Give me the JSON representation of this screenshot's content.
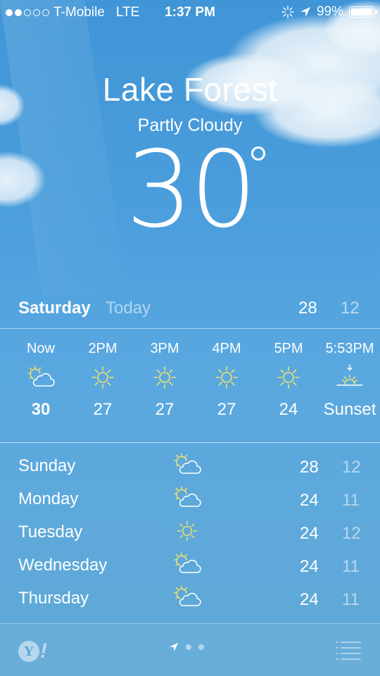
{
  "status": {
    "carrier": "T-Mobile",
    "network": "LTE",
    "time": "1:37 PM",
    "battery": "99%",
    "battery_level": 0.99,
    "signal_bars_filled": 2,
    "signal_bars_total": 5
  },
  "location": {
    "city": "Lake Forest",
    "condition": "Partly Cloudy",
    "temperature": "30"
  },
  "today": {
    "day": "Saturday",
    "label": "Today",
    "high": "28",
    "low": "12"
  },
  "hourly": [
    {
      "time": "Now",
      "icon": "partly-cloudy-icon",
      "value": "30",
      "bold": true
    },
    {
      "time": "2PM",
      "icon": "sun-icon",
      "value": "27"
    },
    {
      "time": "3PM",
      "icon": "sun-icon",
      "value": "27"
    },
    {
      "time": "4PM",
      "icon": "sun-icon",
      "value": "27"
    },
    {
      "time": "5PM",
      "icon": "sun-icon",
      "value": "24"
    },
    {
      "time": "5:53PM",
      "icon": "sunset-icon",
      "value": "Sunset"
    }
  ],
  "daily": [
    {
      "day": "Sunday",
      "icon": "partly-cloudy-icon",
      "high": "28",
      "low": "12"
    },
    {
      "day": "Monday",
      "icon": "partly-cloudy-icon",
      "high": "24",
      "low": "11"
    },
    {
      "day": "Tuesday",
      "icon": "sun-icon",
      "high": "24",
      "low": "12"
    },
    {
      "day": "Wednesday",
      "icon": "partly-cloudy-icon",
      "high": "24",
      "low": "11"
    },
    {
      "day": "Thursday",
      "icon": "partly-cloudy-icon",
      "high": "24",
      "low": "11"
    }
  ],
  "footer": {
    "yahoo_letter": "Y",
    "yahoo_bang": "!",
    "active_page": "location"
  },
  "colors": {
    "sky": "#4d9fdd",
    "icon_yellow": "#f2e36a"
  }
}
